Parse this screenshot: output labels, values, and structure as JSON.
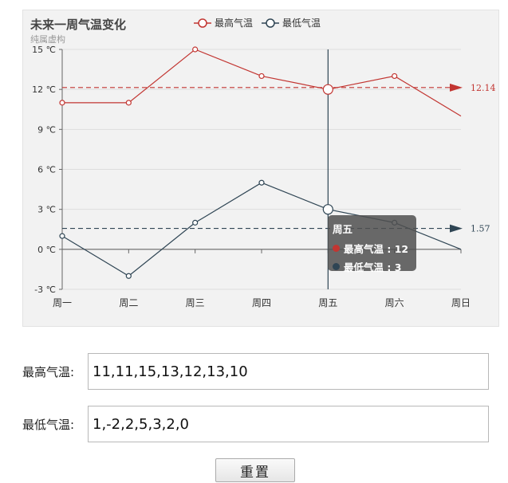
{
  "chart": {
    "title": "未来一周气温变化",
    "subtitle": "纯属虚构"
  },
  "chart_data": {
    "type": "line",
    "title": "未来一周气温变化",
    "subtitle": "纯属虚构",
    "categories": [
      "周一",
      "周二",
      "周三",
      "周四",
      "周五",
      "周六",
      "周日"
    ],
    "yticks": [
      "-3 ℃",
      "0 ℃",
      "3 ℃",
      "6 ℃",
      "9 ℃",
      "12 ℃",
      "15 ℃"
    ],
    "ylim": [
      -3,
      15
    ],
    "series": [
      {
        "name": "最高气温",
        "values": [
          11,
          11,
          15,
          13,
          12,
          13,
          10
        ],
        "color": "#c23531",
        "average_label": "12.14",
        "average": 12.14
      },
      {
        "name": "最低气温",
        "values": [
          1,
          -2,
          2,
          5,
          3,
          2,
          0
        ],
        "color": "#2f4554",
        "average_label": "1.57",
        "average": 1.57
      }
    ],
    "legend_position": "top",
    "tooltip": {
      "title": "周五",
      "rows": [
        {
          "label": "最高气温 : 12",
          "color": "#c23531"
        },
        {
          "label": "最低气温 : 3",
          "color": "#2f4554"
        }
      ]
    }
  },
  "form": {
    "high_label": "最高气温:",
    "high_value": "11,11,15,13,12,13,10",
    "low_label": "最低气温:",
    "low_value": "1,-2,2,5,3,2,0",
    "reset_label": "重置"
  }
}
